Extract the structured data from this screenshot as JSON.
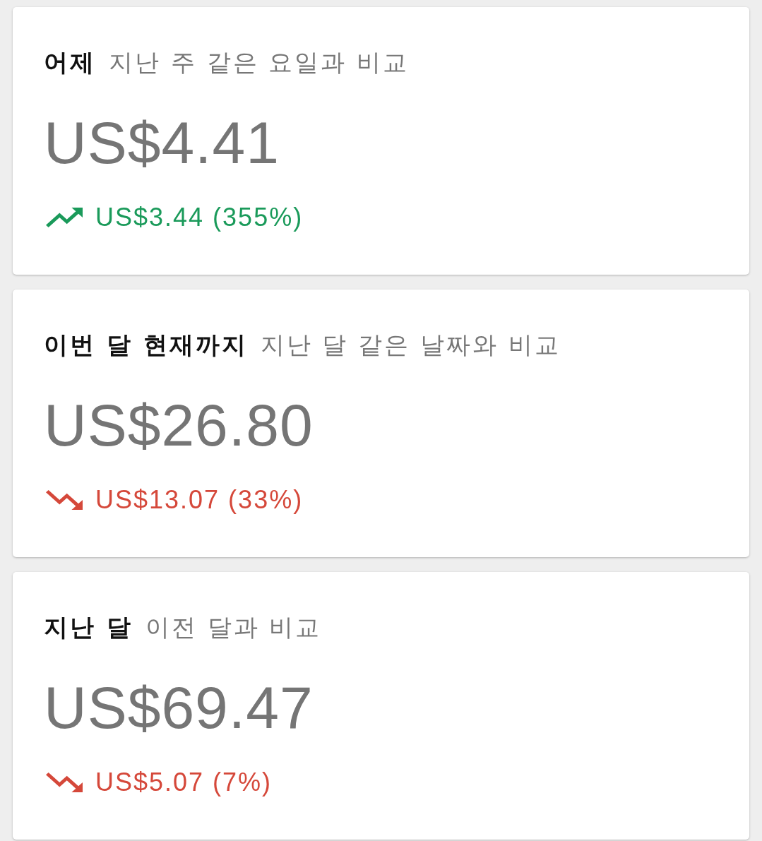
{
  "cards": [
    {
      "period": "어제",
      "comparison": "지난 주 같은 요일과 비교",
      "amount": "US$4.41",
      "change": {
        "kind": "up",
        "text": "US$3.44 (355%)"
      }
    },
    {
      "period": "이번 달 현재까지",
      "comparison": "지난 달 같은 날짜와 비교",
      "amount": "US$26.80",
      "change": {
        "kind": "down",
        "text": "US$13.07 (33%)"
      }
    },
    {
      "period": "지난 달",
      "comparison": "이전 달과 비교",
      "amount": "US$69.47",
      "change": {
        "kind": "down",
        "text": "US$5.07 (7%)"
      }
    }
  ]
}
